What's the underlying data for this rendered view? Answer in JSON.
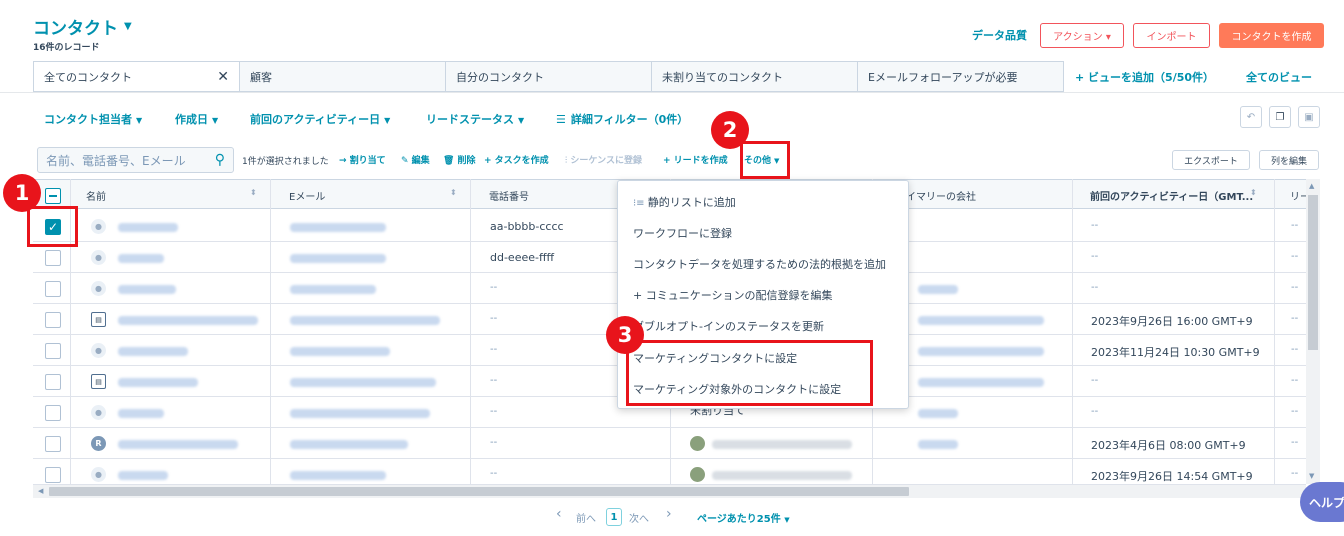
{
  "header": {
    "title": "コンタクト",
    "record_count": "16件のレコード",
    "data_quality": "データ品質",
    "actions": "アクション ▾",
    "import": "インポート",
    "create": "コンタクトを作成"
  },
  "tabs": {
    "items": [
      "全てのコンタクト",
      "顧客",
      "自分のコンタクト",
      "未割り当てのコンタクト",
      "Eメールフォローアップが必要"
    ],
    "close": "✕",
    "add_view": "+ ビューを追加（5/50件）",
    "all_views": "全てのビュー"
  },
  "filters": {
    "owner": "コンタクト担当者",
    "created": "作成日",
    "last_activity": "前回のアクティビティー日",
    "lead_status": "リードステータス",
    "advanced": "詳細フィルター（0件）"
  },
  "search": {
    "placeholder": "名前、電話番号、Eメール"
  },
  "bulk": {
    "selected": "1件が選択されました",
    "assign": "→ 割り当て",
    "edit": "✎ 編集",
    "delete": "🗑 削除",
    "task": "+ タスクを作成",
    "sequence": "シーケンスに登録",
    "lead": "+ リードを作成",
    "more": "その他",
    "export": "エクスポート",
    "edit_columns": "列を編集"
  },
  "table": {
    "headers": {
      "name": "名前",
      "email": "Eメール",
      "phone": "電話番号",
      "company": "イマリーの会社",
      "last_activity": "前回のアクティビティー日（GMT...",
      "lead": "リー"
    },
    "rows": [
      {
        "checked": true,
        "avatar": "person",
        "phone": "aa-bbbb-cccc",
        "owner": "",
        "activity": "--",
        "lead": "--"
      },
      {
        "checked": false,
        "avatar": "person",
        "phone": "dd-eeee-ffff",
        "owner": "",
        "activity": "--",
        "lead": "--"
      },
      {
        "checked": false,
        "avatar": "person",
        "phone": "--",
        "owner": "",
        "activity": "--",
        "lead": "--"
      },
      {
        "checked": false,
        "avatar": "company",
        "phone": "--",
        "owner": "",
        "activity": "2023年9月26日 16:00 GMT+9",
        "lead": "--"
      },
      {
        "checked": false,
        "avatar": "person",
        "phone": "--",
        "owner": "",
        "activity": "2023年11月24日 10:30 GMT+9",
        "lead": "--"
      },
      {
        "checked": false,
        "avatar": "company",
        "phone": "--",
        "owner": "",
        "activity": "--",
        "lead": "--"
      },
      {
        "checked": false,
        "avatar": "person",
        "phone": "--",
        "owner": "未割り当て",
        "activity": "--",
        "lead": "--"
      },
      {
        "checked": false,
        "avatar": "R",
        "phone": "--",
        "owner": "",
        "activity": "2023年4月6日 08:00 GMT+9",
        "lead": "--"
      },
      {
        "checked": false,
        "avatar": "person",
        "phone": "--",
        "owner": "",
        "activity": "2023年9月26日 14:54 GMT+9",
        "lead": "--"
      }
    ]
  },
  "menu": {
    "items": [
      "静的リストに追加",
      "ワークフローに登録",
      "コンタクトデータを処理するための法的根拠を追加",
      "+ コミュニケーションの配信登録を編集",
      "ダブルオプト‐インのステータスを更新",
      "マーケティングコンタクトに設定",
      "マーケティング対象外のコンタクトに設定"
    ]
  },
  "annotations": {
    "badge1": "1",
    "badge2": "2",
    "badge3": "3"
  },
  "pager": {
    "prev": "前へ",
    "page": "1",
    "next": "次へ",
    "per_page": "ページあたり25件"
  },
  "help": "ヘルプ",
  "colors": {
    "accent": "#0091ae",
    "orange": "#ff7a59",
    "annotation_red": "#e8141b"
  }
}
